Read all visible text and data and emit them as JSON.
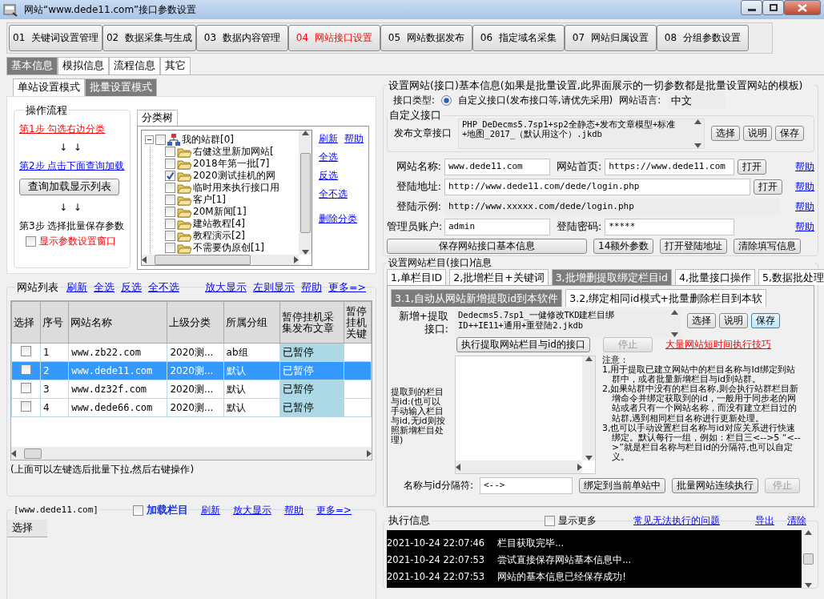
{
  "window": {
    "title": "网站“www.dede11.com”接口参数设置"
  },
  "main_tabs": [
    {
      "label": "01  关键词设置管理",
      "selected": false
    },
    {
      "label": "02  数据采集与生成",
      "selected": false
    },
    {
      "label": "03  数据内容管理",
      "selected": false
    },
    {
      "label": "04  网站接口设置",
      "selected": true
    },
    {
      "label": "05  网站数据发布",
      "selected": false
    },
    {
      "label": "06  指定域名采集",
      "selected": false
    },
    {
      "label": "07  网站归属设置",
      "selected": false
    },
    {
      "label": "08  分组参数设置",
      "selected": false
    }
  ],
  "sub_tabs": [
    {
      "label": "基本信息",
      "selected": true
    },
    {
      "label": "模拟信息",
      "selected": false
    },
    {
      "label": "流程信息",
      "selected": false
    },
    {
      "label": "其它",
      "selected": false
    }
  ],
  "mode_tabs": [
    {
      "label": "单站设置模式",
      "selected": false
    },
    {
      "label": "批量设置模式",
      "selected": true
    }
  ],
  "flow": {
    "title": "操作流程",
    "step1": "第1步  勾选右边分类",
    "arrows1": "↓  ↓",
    "step2": "第2步  点击下面查询加载",
    "load_button": "查询加载显示列表",
    "arrows2": "↓  ↓",
    "step3": "第3步  选择批量保存参数",
    "show_window": {
      "label": "显示参数设置窗口",
      "checked": false
    }
  },
  "category_tree": {
    "tab": "分类树",
    "root": {
      "label": "我的站群[0]",
      "checked": false,
      "expanded": true,
      "children": [
        {
          "label": "右健这里新加网站[",
          "checked": false
        },
        {
          "label": "2018年第一批[7]",
          "checked": false
        },
        {
          "label": "2020测试挂机的网",
          "checked": true
        },
        {
          "label": "临时用来执行接口用",
          "checked": false
        },
        {
          "label": "客户[1]",
          "checked": false
        },
        {
          "label": "20M新闻[1]",
          "checked": false
        },
        {
          "label": "建站教程[4]",
          "checked": false
        },
        {
          "label": "教程演示[2]",
          "checked": false
        },
        {
          "label": "不需要伪原创[1]",
          "checked": false
        }
      ]
    },
    "links": [
      "刷新",
      "帮助",
      "全选",
      "反选",
      "全不选",
      "删除分类"
    ]
  },
  "site_list": {
    "title": "网站列表",
    "links": [
      "刷新",
      "全选",
      "反选",
      "全不选",
      "放大显示",
      "左则显示",
      "帮助",
      "更多=>"
    ],
    "columns": [
      "选择",
      "序号",
      "网站名称",
      "上级分类",
      "所属分组",
      "暂停挂机采集发布文章",
      "暂停挂机关键"
    ],
    "rows": [
      {
        "checked": false,
        "selected": false,
        "cells": [
          "",
          "1",
          "www.zb22.com",
          "2020测...",
          "ab组",
          "已暂停"
        ]
      },
      {
        "checked": false,
        "selected": true,
        "cells": [
          "",
          "2",
          "www.dede11.com",
          "2020测...",
          "默认",
          "已暂停"
        ]
      },
      {
        "checked": false,
        "selected": false,
        "cells": [
          "",
          "3",
          "www.dz32f.com",
          "2020测...",
          "默认",
          "已暂停"
        ]
      },
      {
        "checked": false,
        "selected": false,
        "cells": [
          "",
          "4",
          "www.dede66.com",
          "2020测...",
          "默认",
          "已暂停"
        ]
      }
    ],
    "note": "(上面可以左键选后批量下拉,然后右键操作)"
  },
  "columns_panel": {
    "title": "[www.dede11.com]",
    "load": {
      "label": "加载栏目",
      "checked": false
    },
    "links": [
      "刷新",
      "放大显示",
      "帮助",
      "更多=>"
    ],
    "column_header": "选择"
  },
  "basic_info": {
    "title": "设置网站(接口)基本信息(如果是批量设置,此界面展示的一切参数都是批量设置网站的模板)",
    "type_label": "接口类型:",
    "type_option": {
      "label": "自定义接口(发布接口等,请优先采用)",
      "selected": true
    },
    "language_label": "网站语言:",
    "language": "中文",
    "custom_title": "自定义接口",
    "publish_label": "发布文章接口",
    "publish_value": "PHP_DeDecms5.7sp1+sp2全静态+发布文章模型+标准+地图_2017_（默认用这个）.jkdb",
    "buttons": [
      "选择",
      "说明",
      "保存"
    ],
    "lines": [
      {
        "items": [
          {
            "kind": "label",
            "text": "网站名称:"
          },
          {
            "kind": "input",
            "text": "www.dede11.com"
          },
          {
            "kind": "label",
            "text": "网站首页:"
          },
          {
            "kind": "input",
            "text": "https://www.dede11.com"
          },
          {
            "kind": "button",
            "text": "打开"
          },
          {
            "kind": "link",
            "text": "帮助"
          }
        ]
      },
      {
        "items": [
          {
            "kind": "label",
            "text": "登陆地址:"
          },
          {
            "kind": "wide",
            "text": "http://www.dede11.com/dede/login.php"
          },
          {
            "kind": "button",
            "text": "打开"
          },
          {
            "kind": "link",
            "text": "帮助"
          }
        ]
      },
      {
        "items": [
          {
            "kind": "label",
            "text": "登陆示例:"
          },
          {
            "kind": "readonly",
            "text": "http://www.xxxxx.com/dede/login.php"
          },
          {
            "kind": "link",
            "text": "帮助"
          }
        ]
      },
      {
        "items": [
          {
            "kind": "label",
            "text": "管理员账户:"
          },
          {
            "kind": "input",
            "text": "admin"
          },
          {
            "kind": "label",
            "text": "登陆密码:"
          },
          {
            "kind": "input",
            "text": "*****"
          },
          {
            "kind": "link",
            "text": "帮助"
          }
        ]
      }
    ],
    "bottom_buttons": [
      "保存网站接口基本信息",
      "14额外参数",
      "打开登陆地址",
      "清除填写信息"
    ]
  },
  "columns_info": {
    "title": "设置网站栏目(接口)信息",
    "tabs": [
      {
        "label": "1,单栏目ID",
        "selected": false
      },
      {
        "label": "2,批增栏目+关键词",
        "selected": false
      },
      {
        "label": "3,批增删提取绑定栏目id",
        "selected": true
      },
      {
        "label": "4,批量接口操作",
        "selected": false
      },
      {
        "label": "5,数据批处理",
        "selected": false
      }
    ],
    "subtabs": [
      {
        "label": "3.1,自动从网站新增提取id到本软件",
        "selected": true
      },
      {
        "label": "3.2,绑定相同id模式+批量删除栏目到本软",
        "selected": false
      }
    ],
    "interface_label": "新增+提取接口:",
    "interface_value": "Dedecms5.7sp1_一健修改TKD建栏目绑ID++IE11+通用+重登陆2.jkdb",
    "buttons": [
      "选择",
      "说明",
      "保存"
    ],
    "run_button": "执行提取网站栏目与id的接口",
    "stop_button": {
      "label": "停止",
      "disabled": true
    },
    "tip_link": "大量网站短时间执行技巧",
    "extracted_label": "提取到的栏目与id:(也可以手动输入栏目与id,无id则按照新增栏目处理)",
    "notes": [
      "注意：",
      "1,用于提取已建立网站中的栏目名称与Id绑定到站群中，或者批量新增栏目与id到站群。",
      "2,如果站群中没有的栏目名称,则会执行站群栏目新增命令并绑定获取到的id，一般用于同步老的网站或者只有一个网站名称，而没有建立栏目过的站群,遇到相同栏目名称进行更新处理。",
      "3,也可以手动设置栏目名称与id对应关系进行快速绑定。默认每行一组，例如：栏目三<-->5 “<-->”就是栏目名称与栏目id的分隔符,也可以自定义。"
    ],
    "separator_label": "名称与id分隔符:",
    "separator_value": "<-->",
    "bottom_buttons": [
      {
        "label": "绑定到当前单站中",
        "disabled": false
      },
      {
        "label": "批量网站连续执行",
        "disabled": false
      },
      {
        "label": "停止",
        "disabled": true
      }
    ]
  },
  "log": {
    "title": "执行信息",
    "show_more": {
      "label": "显示更多",
      "checked": false
    },
    "links": [
      "常见无法执行的问题",
      "导出",
      "清除"
    ],
    "entries": [
      {
        "time": "2021-10-24 22:07:46",
        "message": "栏目获取完毕..."
      },
      {
        "time": "2021-10-24 22:07:53",
        "message": "尝试直接保存网站基本信息中..."
      },
      {
        "time": "2021-10-24 22:07:53",
        "message": "网站的基本信息已经保存成功!"
      }
    ]
  }
}
